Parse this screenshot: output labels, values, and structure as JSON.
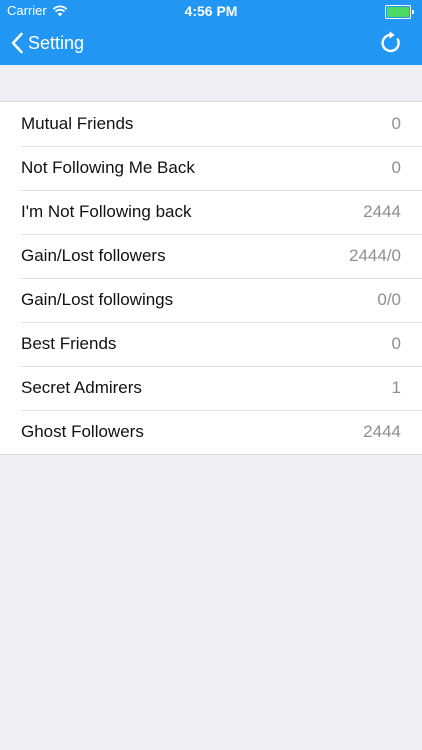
{
  "status_bar": {
    "carrier": "Carrier",
    "time": "4:56 PM",
    "battery_percent": 100
  },
  "nav": {
    "back_label": "Setting",
    "refresh_icon": "refresh-icon"
  },
  "colors": {
    "accent": "#2196F3",
    "background": "#EEEEF3",
    "value_text": "#8E8E93",
    "battery": "#4CD964"
  },
  "list": {
    "items": [
      {
        "label": "Mutual Friends",
        "value": "0"
      },
      {
        "label": "Not Following Me Back",
        "value": "0"
      },
      {
        "label": "I'm Not Following back",
        "value": "2444"
      },
      {
        "label": "Gain/Lost followers",
        "value": "2444/0"
      },
      {
        "label": "Gain/Lost followings",
        "value": "0/0"
      },
      {
        "label": "Best Friends",
        "value": "0"
      },
      {
        "label": "Secret Admirers",
        "value": "1"
      },
      {
        "label": "Ghost Followers",
        "value": "2444"
      }
    ]
  }
}
